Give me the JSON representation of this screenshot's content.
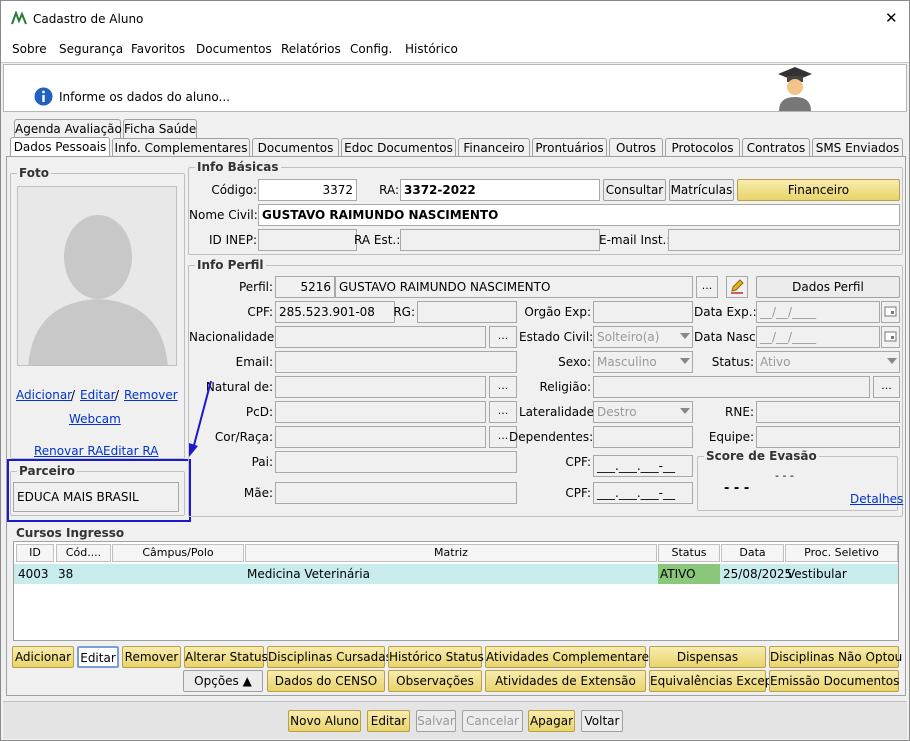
{
  "window": {
    "title": "Cadastro de Aluno",
    "close": "✕"
  },
  "menu": [
    "Sobre",
    "Segurança",
    "Favoritos",
    "Documentos",
    "Relatórios",
    "Config.",
    "Histórico"
  ],
  "info": {
    "message": "Informe os dados do aluno..."
  },
  "tabs_row1": [
    "Agenda Avaliação",
    "Ficha Saúde"
  ],
  "tabs_row2": [
    "Dados Pessoais",
    "Info. Complementares",
    "Documentos",
    "Edoc Documentos",
    "Financeiro",
    "Prontuários",
    "Outros",
    "Protocolos",
    "Contratos",
    "SMS Enviados"
  ],
  "foto": {
    "legend": "Foto",
    "adicionar": "Adicionar",
    "sep1": "/",
    "editar": "Editar",
    "sep2": "/",
    "remover": "Remover",
    "webcam": "Webcam",
    "renovar_ra": "Renovar RA",
    "editar_ra": "Editar RA"
  },
  "parceiro": {
    "legend": "Parceiro",
    "value": "EDUCA MAIS BRASIL"
  },
  "info_basicas": {
    "legend": "Info Básicas",
    "codigo_label": "Código:",
    "codigo": "3372",
    "ra_label": "RA:",
    "ra": "3372-2022",
    "consultar": "Consultar",
    "matriculas": "Matrículas",
    "financeiro": "Financeiro",
    "nome_label": "Nome Civil:",
    "nome": "GUSTAVO RAIMUNDO NASCIMENTO",
    "idinep_label": "ID INEP:",
    "idinep": "",
    "raest_label": "RA Est.:",
    "raest": "",
    "email_inst_label": "E-mail Inst.:",
    "email_inst": ""
  },
  "info_perfil": {
    "legend": "Info Perfil",
    "perfil_label": "Perfil:",
    "perfil_id": "5216",
    "perfil_nome": "GUSTAVO RAIMUNDO NASCIMENTO",
    "ellipsis": "...",
    "dados_perfil": "Dados Perfil",
    "cpf_label": "CPF:",
    "cpf": "285.523.901-08",
    "rg_label": "RG:",
    "rg": "",
    "orgao_label": "Orgão Exp:",
    "orgao": "",
    "dataexp_label": "Data Exp.:",
    "dataexp": "__/__/____",
    "nacionalidade_label": "Nacionalidade:",
    "nacionalidade": "",
    "estadocivil_label": "Estado Civil:",
    "estadocivil": "Solteiro(a)",
    "datanasc_label": "Data Nasc.:",
    "datanasc": "__/__/____",
    "email_label": "Email:",
    "email": "",
    "sexo_label": "Sexo:",
    "sexo": "Masculino",
    "status_label": "Status:",
    "status": "Ativo",
    "natural_label": "Natural de:",
    "natural": "",
    "religiao_label": "Religião:",
    "religiao": "",
    "pcd_label": "PcD:",
    "pcd": "",
    "lateralidade_label": "Lateralidade:",
    "lateralidade": "Destro",
    "rne_label": "RNE:",
    "rne": "",
    "cor_label": "Cor/Raça:",
    "cor": "",
    "dependentes_label": "Dependentes:",
    "dependentes": "",
    "equipe_label": "Equipe:",
    "equipe": "",
    "pai_label": "Pai:",
    "pai": "",
    "cpf_pai_label": "CPF:",
    "cpf_pai": "___.___.___-__",
    "mae_label": "Mãe:",
    "mae": "",
    "cpf_mae_label": "CPF:",
    "cpf_mae": "___.___.___-__",
    "score_legend": "Score de Evasão",
    "score_small": "- - -",
    "score_big": "- - -",
    "detalhes": "Detalhes"
  },
  "cursos": {
    "legend": "Cursos Ingresso",
    "headers": [
      "ID",
      "Cód....",
      "Câmpus/Polo",
      "Matriz",
      "Status",
      "Data",
      "Proc. Seletivo"
    ],
    "rows": [
      [
        "4003",
        "38",
        "",
        "Medicina Veterinária",
        "ATIVO",
        "25/08/2025",
        "Vestibular"
      ]
    ]
  },
  "actions1": [
    "Adicionar",
    "Editar",
    "Remover",
    "Alterar Status",
    "Disciplinas Cursadas",
    "Histórico Status",
    "Atividades Complementares",
    "Dispensas",
    "Disciplinas Não Optou"
  ],
  "actions2": [
    "Opções ▲",
    "Dados do CENSO",
    "Observações",
    "Atividades de Extensão",
    "Equivalências Excep.",
    "Emissão Documentos"
  ],
  "footer": [
    "Novo Aluno",
    "Editar",
    "Salvar",
    "Cancelar",
    "Apagar",
    "Voltar"
  ],
  "colors": {
    "accent_yellow": "#e8d46a",
    "highlight_row": "#c8ecec",
    "status_green": "#8bc77a",
    "annotation_blue": "#1a1acc"
  }
}
